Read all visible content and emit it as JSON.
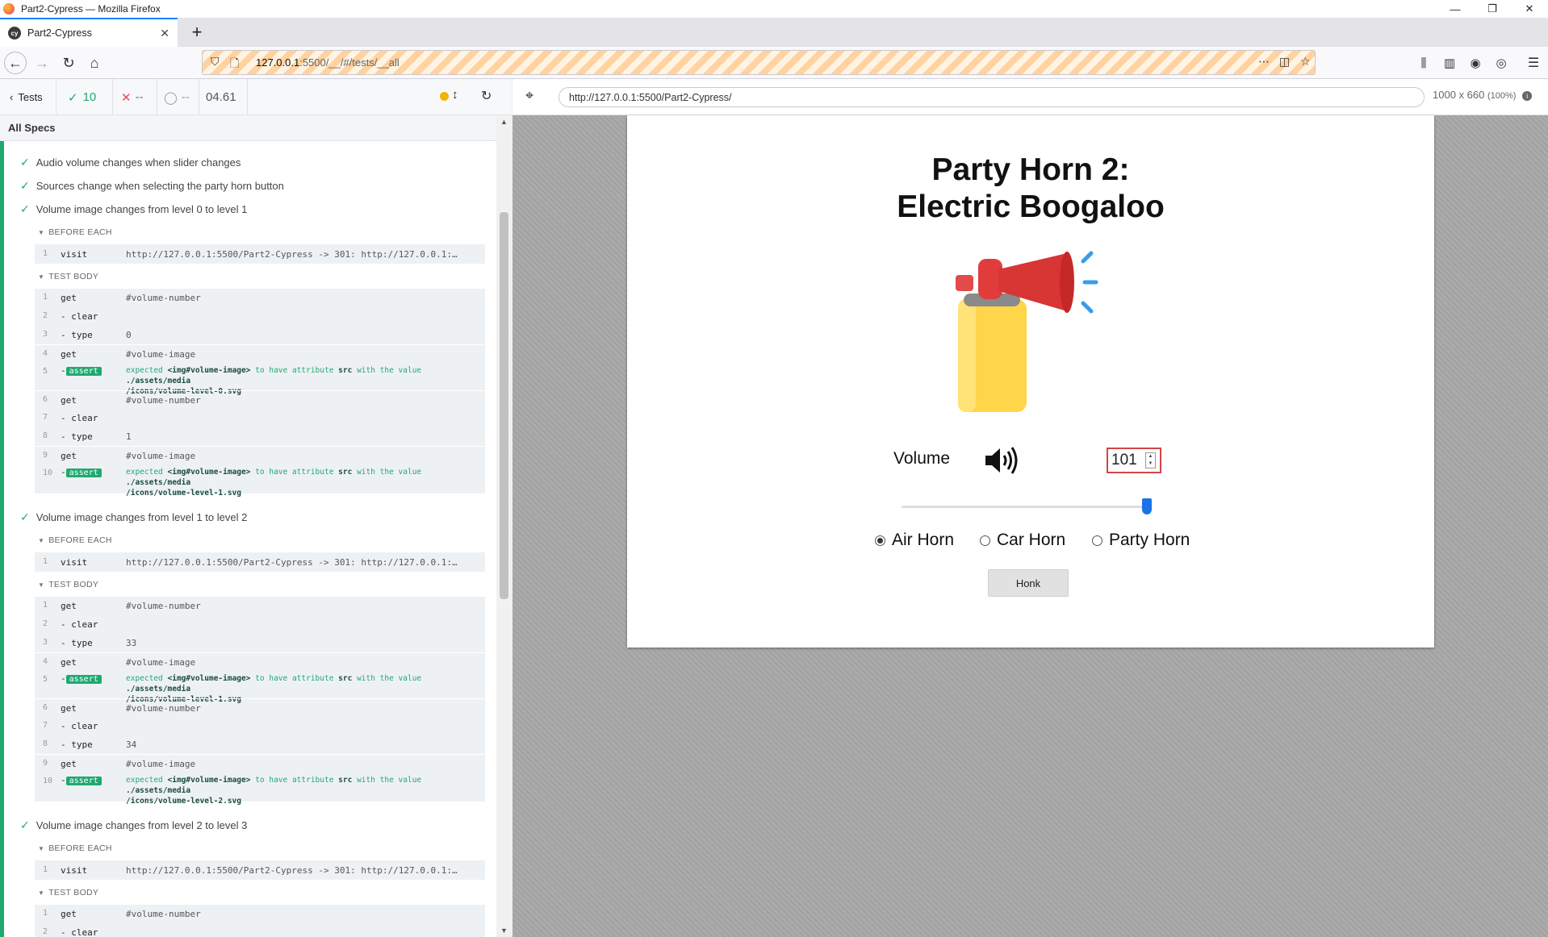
{
  "window": {
    "title": "Part2-Cypress — Mozilla Firefox"
  },
  "tab": {
    "title": "Part2-Cypress"
  },
  "urlbar": {
    "host": "127.0.0.1",
    "rest": ":5500/__/#/tests/__all"
  },
  "reporter": {
    "back_label": "Tests",
    "passed": "10",
    "failed": "--",
    "pending": "--",
    "duration": "04.61",
    "all_specs": "All Specs",
    "tests": [
      {
        "title": "Audio volume changes when slider changes"
      },
      {
        "title": "Sources change when selecting the party horn button"
      },
      {
        "title": "Volume image changes from level 0 to level 1",
        "before_each_label": "BEFORE EACH",
        "test_body_label": "TEST BODY",
        "visit": {
          "n": "1",
          "name": "visit",
          "msg": "http://127.0.0.1:5500/Part2-Cypress -> 301: http://127.0.0.1:…"
        },
        "commands": [
          {
            "n": "1",
            "name": "get",
            "msg": "#volume-number"
          },
          {
            "n": "2",
            "name": "- clear",
            "msg": ""
          },
          {
            "n": "3",
            "name": "- type",
            "msg": "0"
          },
          {
            "n": "4",
            "name": "get",
            "msg": "#volume-image"
          },
          {
            "n": "5",
            "name": "-",
            "badge": "assert",
            "a1": "expected",
            "a2": "<img#volume-image>",
            "a3": "to have attribute",
            "a4": "src",
            "a5": "with the value",
            "a6": "./assets/media",
            "a7": "/icons/volume-level-0.svg"
          },
          {
            "n": "6",
            "name": "get",
            "msg": "#volume-number"
          },
          {
            "n": "7",
            "name": "- clear",
            "msg": ""
          },
          {
            "n": "8",
            "name": "- type",
            "msg": "1"
          },
          {
            "n": "9",
            "name": "get",
            "msg": "#volume-image"
          },
          {
            "n": "10",
            "name": "-",
            "badge": "assert",
            "a1": "expected",
            "a2": "<img#volume-image>",
            "a3": "to have attribute",
            "a4": "src",
            "a5": "with the value",
            "a6": "./assets/media",
            "a7": "/icons/volume-level-1.svg"
          }
        ]
      },
      {
        "title": "Volume image changes from level 1 to level 2",
        "before_each_label": "BEFORE EACH",
        "test_body_label": "TEST BODY",
        "visit": {
          "n": "1",
          "name": "visit",
          "msg": "http://127.0.0.1:5500/Part2-Cypress -> 301: http://127.0.0.1:…"
        },
        "commands": [
          {
            "n": "1",
            "name": "get",
            "msg": "#volume-number"
          },
          {
            "n": "2",
            "name": "- clear",
            "msg": ""
          },
          {
            "n": "3",
            "name": "- type",
            "msg": "33"
          },
          {
            "n": "4",
            "name": "get",
            "msg": "#volume-image"
          },
          {
            "n": "5",
            "name": "-",
            "badge": "assert",
            "a1": "expected",
            "a2": "<img#volume-image>",
            "a3": "to have attribute",
            "a4": "src",
            "a5": "with the value",
            "a6": "./assets/media",
            "a7": "/icons/volume-level-1.svg"
          },
          {
            "n": "6",
            "name": "get",
            "msg": "#volume-number"
          },
          {
            "n": "7",
            "name": "- clear",
            "msg": ""
          },
          {
            "n": "8",
            "name": "- type",
            "msg": "34"
          },
          {
            "n": "9",
            "name": "get",
            "msg": "#volume-image"
          },
          {
            "n": "10",
            "name": "-",
            "badge": "assert",
            "a1": "expected",
            "a2": "<img#volume-image>",
            "a3": "to have attribute",
            "a4": "src",
            "a5": "with the value",
            "a6": "./assets/media",
            "a7": "/icons/volume-level-2.svg"
          }
        ]
      },
      {
        "title": "Volume image changes from level 2 to level 3",
        "before_each_label": "BEFORE EACH",
        "test_body_label": "TEST BODY",
        "visit": {
          "n": "1",
          "name": "visit",
          "msg": "http://127.0.0.1:5500/Part2-Cypress -> 301: http://127.0.0.1:…"
        },
        "commands": [
          {
            "n": "1",
            "name": "get",
            "msg": "#volume-number"
          },
          {
            "n": "2",
            "name": "- clear",
            "msg": ""
          }
        ]
      }
    ]
  },
  "aut": {
    "url": "http://127.0.0.1:5500/Part2-Cypress/",
    "size": "1000 x 660",
    "zoom": "(100%)",
    "title_line1": "Party Horn 2:",
    "title_line2": "Electric Boogaloo",
    "volume_label": "Volume",
    "volume_value": "101",
    "slider_fraction": 1.0,
    "radios": [
      {
        "label": "Air Horn",
        "checked": true
      },
      {
        "label": "Car Horn",
        "checked": false
      },
      {
        "label": "Party Horn",
        "checked": false
      }
    ],
    "honk_label": "Honk"
  }
}
